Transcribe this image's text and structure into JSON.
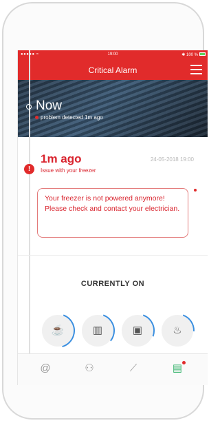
{
  "status_bar": {
    "signal": "●●●●● ≈",
    "time": "19:00",
    "battery": "✱ 100 %"
  },
  "nav": {
    "title": "Critical Alarm",
    "menu_icon": "hamburger-menu-icon"
  },
  "hero": {
    "title": "Now",
    "subtitle": "problem detected 1m ago"
  },
  "event": {
    "time_ago": "1m ago",
    "issue": "Issue with your freezer",
    "date": "24-05-2018 19:00",
    "message": "Your freezer is not powered anymore! Please check and contact your electrician."
  },
  "section": {
    "heading": "CURRENTLY ON"
  },
  "devices": [
    {
      "icon": "kettle-icon",
      "glyph": "☕",
      "level": 0.4
    },
    {
      "icon": "radiator-icon",
      "glyph": "▥",
      "level": 0.3
    },
    {
      "icon": "washer-icon",
      "glyph": "▣",
      "level": 0.25
    },
    {
      "icon": "iron-icon",
      "glyph": "♨",
      "level": 0.2
    }
  ],
  "tabs": [
    {
      "icon": "at-icon",
      "glyph": "@"
    },
    {
      "icon": "nodes-icon",
      "glyph": "⚇"
    },
    {
      "icon": "chart-line-icon",
      "glyph": "⟋"
    },
    {
      "icon": "clipboard-icon",
      "glyph": "▤",
      "active": true
    }
  ],
  "colors": {
    "accent": "#e12b2b",
    "active_tab": "#34b36b",
    "ring": "#3b8fe0"
  }
}
